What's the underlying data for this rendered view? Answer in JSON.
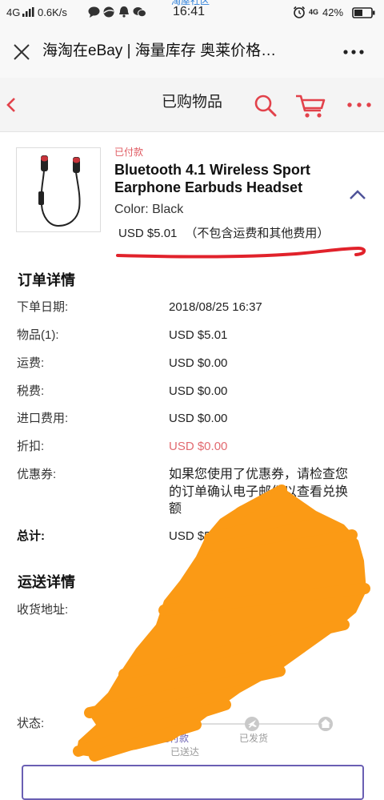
{
  "status_bar": {
    "network": "4G",
    "speed": "0.6K/s",
    "time": "16:41",
    "watermark": "淘屋社区",
    "network_right": "4G",
    "battery": "42%",
    "icons": [
      "signal-bars-icon",
      "message-icon",
      "ball-icon",
      "notification-icon",
      "wechat-icon",
      "alarm-icon",
      "battery-icon"
    ]
  },
  "browser_bar": {
    "title": "海淘在eBay | 海量库存 奥莱价格…",
    "icons": [
      "close-icon",
      "more-icon"
    ]
  },
  "header": {
    "title": "已购物品",
    "icons": [
      "back-icon",
      "search-icon",
      "cart-icon",
      "more-icon"
    ]
  },
  "item": {
    "status": "已付款",
    "title": "Bluetooth 4.1 Wireless Sport Earphone Earbuds Headset",
    "color": "Color: Black",
    "price": "USD $5.01",
    "price_note": "（不包含运费和其他费用）",
    "icons": [
      "chevron-up-icon"
    ]
  },
  "order_details": {
    "heading": "订单详情",
    "rows": [
      {
        "label": "下单日期:",
        "value": "2018/08/25 16:37"
      },
      {
        "label": "物品(1):",
        "value": "USD $5.01"
      },
      {
        "label": "运费:",
        "value": "USD $0.00"
      },
      {
        "label": "税费:",
        "value": "USD $0.00"
      },
      {
        "label": "进口费用:",
        "value": "USD $0.00"
      },
      {
        "label": "折扣:",
        "value": "USD $0.00"
      },
      {
        "label": "优惠券:",
        "value": "如果您使用了优惠券，请检查您的订单确认电子邮件以查看兑换额"
      }
    ],
    "total": {
      "label": "总计:",
      "value": "USD $5"
    }
  },
  "shipping": {
    "heading": "运送详情",
    "address_label": "收货地址:",
    "status_label": "状态:",
    "steps": [
      {
        "label": "已付款",
        "active": true,
        "icon": "dot-icon"
      },
      {
        "label": "已发货",
        "active": false,
        "icon": "plane-icon"
      },
      {
        "label": "已送达",
        "active": false,
        "icon": "home-icon"
      }
    ]
  },
  "colors": {
    "ebay_accent": "#e2424b",
    "status_paid": "#e05b62",
    "discount_value": "#e26a70",
    "step_active": "#6a5fb3",
    "chevron": "#4f5399",
    "annotation_underline": "#e1222b",
    "scribble": "#fb9a15",
    "watermark": "#2f80d8"
  }
}
